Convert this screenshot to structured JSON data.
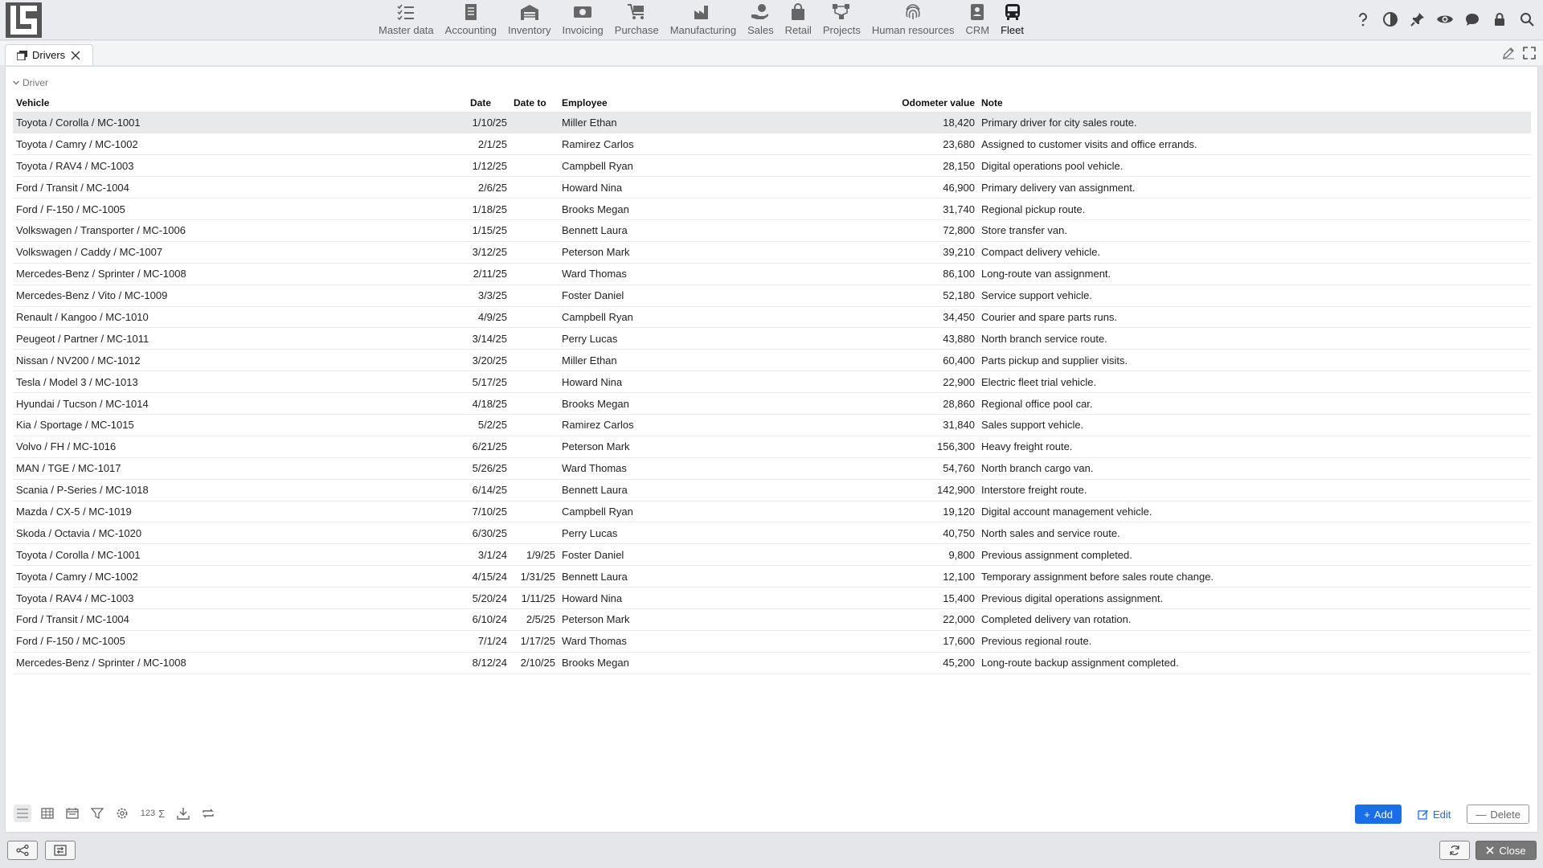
{
  "modules": [
    {
      "label": "Master data",
      "icon": "checklist-icon"
    },
    {
      "label": "Accounting",
      "icon": "ledger-icon"
    },
    {
      "label": "Inventory",
      "icon": "warehouse-icon"
    },
    {
      "label": "Invoicing",
      "icon": "cash-icon"
    },
    {
      "label": "Purchase",
      "icon": "cart-icon"
    },
    {
      "label": "Manufacturing",
      "icon": "factory-icon"
    },
    {
      "label": "Sales",
      "icon": "hand-money-icon"
    },
    {
      "label": "Retail",
      "icon": "bag-icon"
    },
    {
      "label": "Projects",
      "icon": "network-icon"
    },
    {
      "label": "Human resources",
      "icon": "fingerprint-icon"
    },
    {
      "label": "CRM",
      "icon": "contact-card-icon"
    },
    {
      "label": "Fleet",
      "icon": "bus-icon"
    }
  ],
  "tab": {
    "label": "Drivers"
  },
  "group_label": "Driver",
  "columns": {
    "vehicle": "Vehicle",
    "date": "Date",
    "date_to": "Date to",
    "employee": "Employee",
    "odometer": "Odometer value",
    "note": "Note"
  },
  "rows": [
    {
      "vehicle": "Toyota / Corolla / MC-1001",
      "date": "1/10/25",
      "date_to": "",
      "employee": "Miller Ethan",
      "odometer": "18,420",
      "note": "Primary driver for city sales route."
    },
    {
      "vehicle": "Toyota / Camry / MC-1002",
      "date": "2/1/25",
      "date_to": "",
      "employee": "Ramirez Carlos",
      "odometer": "23,680",
      "note": "Assigned to customer visits and office errands."
    },
    {
      "vehicle": "Toyota / RAV4 / MC-1003",
      "date": "1/12/25",
      "date_to": "",
      "employee": "Campbell Ryan",
      "odometer": "28,150",
      "note": "Digital operations pool vehicle."
    },
    {
      "vehicle": "Ford / Transit / MC-1004",
      "date": "2/6/25",
      "date_to": "",
      "employee": "Howard Nina",
      "odometer": "46,900",
      "note": "Primary delivery van assignment."
    },
    {
      "vehicle": "Ford / F-150 / MC-1005",
      "date": "1/18/25",
      "date_to": "",
      "employee": "Brooks Megan",
      "odometer": "31,740",
      "note": "Regional pickup route."
    },
    {
      "vehicle": "Volkswagen / Transporter / MC-1006",
      "date": "1/15/25",
      "date_to": "",
      "employee": "Bennett Laura",
      "odometer": "72,800",
      "note": "Store transfer van."
    },
    {
      "vehicle": "Volkswagen / Caddy / MC-1007",
      "date": "3/12/25",
      "date_to": "",
      "employee": "Peterson Mark",
      "odometer": "39,210",
      "note": "Compact delivery vehicle."
    },
    {
      "vehicle": "Mercedes-Benz / Sprinter / MC-1008",
      "date": "2/11/25",
      "date_to": "",
      "employee": "Ward Thomas",
      "odometer": "86,100",
      "note": "Long-route van assignment."
    },
    {
      "vehicle": "Mercedes-Benz / Vito / MC-1009",
      "date": "3/3/25",
      "date_to": "",
      "employee": "Foster Daniel",
      "odometer": "52,180",
      "note": "Service support vehicle."
    },
    {
      "vehicle": "Renault / Kangoo / MC-1010",
      "date": "4/9/25",
      "date_to": "",
      "employee": "Campbell Ryan",
      "odometer": "34,450",
      "note": "Courier and spare parts runs."
    },
    {
      "vehicle": "Peugeot / Partner / MC-1011",
      "date": "3/14/25",
      "date_to": "",
      "employee": "Perry Lucas",
      "odometer": "43,880",
      "note": "North branch service route."
    },
    {
      "vehicle": "Nissan / NV200 / MC-1012",
      "date": "3/20/25",
      "date_to": "",
      "employee": "Miller Ethan",
      "odometer": "60,400",
      "note": "Parts pickup and supplier visits."
    },
    {
      "vehicle": "Tesla / Model 3 / MC-1013",
      "date": "5/17/25",
      "date_to": "",
      "employee": "Howard Nina",
      "odometer": "22,900",
      "note": "Electric fleet trial vehicle."
    },
    {
      "vehicle": "Hyundai / Tucson / MC-1014",
      "date": "4/18/25",
      "date_to": "",
      "employee": "Brooks Megan",
      "odometer": "28,860",
      "note": "Regional office pool car."
    },
    {
      "vehicle": "Kia / Sportage / MC-1015",
      "date": "5/2/25",
      "date_to": "",
      "employee": "Ramirez Carlos",
      "odometer": "31,840",
      "note": "Sales support vehicle."
    },
    {
      "vehicle": "Volvo / FH / MC-1016",
      "date": "6/21/25",
      "date_to": "",
      "employee": "Peterson Mark",
      "odometer": "156,300",
      "note": "Heavy freight route."
    },
    {
      "vehicle": "MAN / TGE / MC-1017",
      "date": "5/26/25",
      "date_to": "",
      "employee": "Ward Thomas",
      "odometer": "54,760",
      "note": "North branch cargo van."
    },
    {
      "vehicle": "Scania / P-Series / MC-1018",
      "date": "6/14/25",
      "date_to": "",
      "employee": "Bennett Laura",
      "odometer": "142,900",
      "note": "Interstore freight route."
    },
    {
      "vehicle": "Mazda / CX-5 / MC-1019",
      "date": "7/10/25",
      "date_to": "",
      "employee": "Campbell Ryan",
      "odometer": "19,120",
      "note": "Digital account management vehicle."
    },
    {
      "vehicle": "Skoda / Octavia / MC-1020",
      "date": "6/30/25",
      "date_to": "",
      "employee": "Perry Lucas",
      "odometer": "40,750",
      "note": "North sales and service route."
    },
    {
      "vehicle": "Toyota / Corolla / MC-1001",
      "date": "3/1/24",
      "date_to": "1/9/25",
      "employee": "Foster Daniel",
      "odometer": "9,800",
      "note": "Previous assignment completed."
    },
    {
      "vehicle": "Toyota / Camry / MC-1002",
      "date": "4/15/24",
      "date_to": "1/31/25",
      "employee": "Bennett Laura",
      "odometer": "12,100",
      "note": "Temporary assignment before sales route change."
    },
    {
      "vehicle": "Toyota / RAV4 / MC-1003",
      "date": "5/20/24",
      "date_to": "1/11/25",
      "employee": "Howard Nina",
      "odometer": "15,400",
      "note": "Previous digital operations assignment."
    },
    {
      "vehicle": "Ford / Transit / MC-1004",
      "date": "6/10/24",
      "date_to": "2/5/25",
      "employee": "Peterson Mark",
      "odometer": "22,000",
      "note": "Completed delivery van rotation."
    },
    {
      "vehicle": "Ford / F-150 / MC-1005",
      "date": "7/1/24",
      "date_to": "1/17/25",
      "employee": "Ward Thomas",
      "odometer": "17,600",
      "note": "Previous regional route."
    },
    {
      "vehicle": "Mercedes-Benz / Sprinter / MC-1008",
      "date": "8/12/24",
      "date_to": "2/10/25",
      "employee": "Brooks Megan",
      "odometer": "45,200",
      "note": "Long-route backup assignment completed."
    }
  ],
  "toolbar": {
    "numbers_label": "123",
    "sum_label": "Σ"
  },
  "actions": {
    "add": "Add",
    "edit": "Edit",
    "delete": "Delete"
  },
  "footer": {
    "close": "Close"
  },
  "colors": {
    "accent": "#1a6fe8",
    "selected_row": "#e8e9eb"
  }
}
